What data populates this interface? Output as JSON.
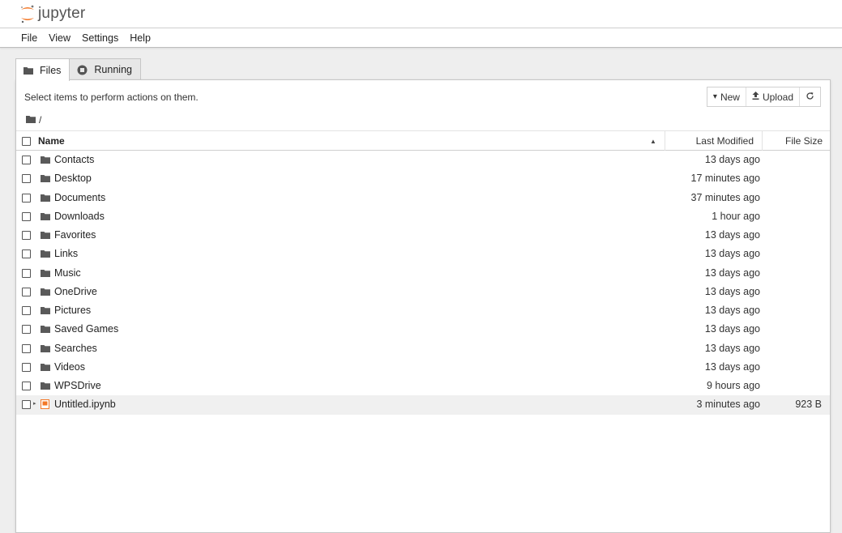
{
  "app": {
    "title": "Jupyter",
    "logo_text": "jupyter"
  },
  "menu": [
    "File",
    "View",
    "Settings",
    "Help"
  ],
  "tabs": [
    {
      "label": "Files",
      "icon": "folder-icon",
      "active": true
    },
    {
      "label": "Running",
      "icon": "circle-stop-icon",
      "active": false
    }
  ],
  "browser": {
    "hint": "Select items to perform actions on them.",
    "toolbar": {
      "new_label": "New",
      "upload_label": "Upload"
    },
    "breadcrumb": "/",
    "columns": {
      "name": "Name",
      "modified": "Last Modified",
      "size": "File Size"
    },
    "items": [
      {
        "name": "Contacts",
        "modified": "13 days ago",
        "size": "",
        "type": "folder"
      },
      {
        "name": "Desktop",
        "modified": "17 minutes ago",
        "size": "",
        "type": "folder"
      },
      {
        "name": "Documents",
        "modified": "37 minutes ago",
        "size": "",
        "type": "folder"
      },
      {
        "name": "Downloads",
        "modified": "1 hour ago",
        "size": "",
        "type": "folder"
      },
      {
        "name": "Favorites",
        "modified": "13 days ago",
        "size": "",
        "type": "folder"
      },
      {
        "name": "Links",
        "modified": "13 days ago",
        "size": "",
        "type": "folder"
      },
      {
        "name": "Music",
        "modified": "13 days ago",
        "size": "",
        "type": "folder"
      },
      {
        "name": "OneDrive",
        "modified": "13 days ago",
        "size": "",
        "type": "folder"
      },
      {
        "name": "Pictures",
        "modified": "13 days ago",
        "size": "",
        "type": "folder"
      },
      {
        "name": "Saved Games",
        "modified": "13 days ago",
        "size": "",
        "type": "folder"
      },
      {
        "name": "Searches",
        "modified": "13 days ago",
        "size": "",
        "type": "folder"
      },
      {
        "name": "Videos",
        "modified": "13 days ago",
        "size": "",
        "type": "folder"
      },
      {
        "name": "WPSDrive",
        "modified": "9 hours ago",
        "size": "",
        "type": "folder"
      },
      {
        "name": "Untitled.ipynb",
        "modified": "3 minutes ago",
        "size": "923 B",
        "type": "notebook"
      }
    ]
  },
  "colors": {
    "brand": "#F37726",
    "folder": "#5a5a5a",
    "selected_row": "#f0f0f0"
  }
}
